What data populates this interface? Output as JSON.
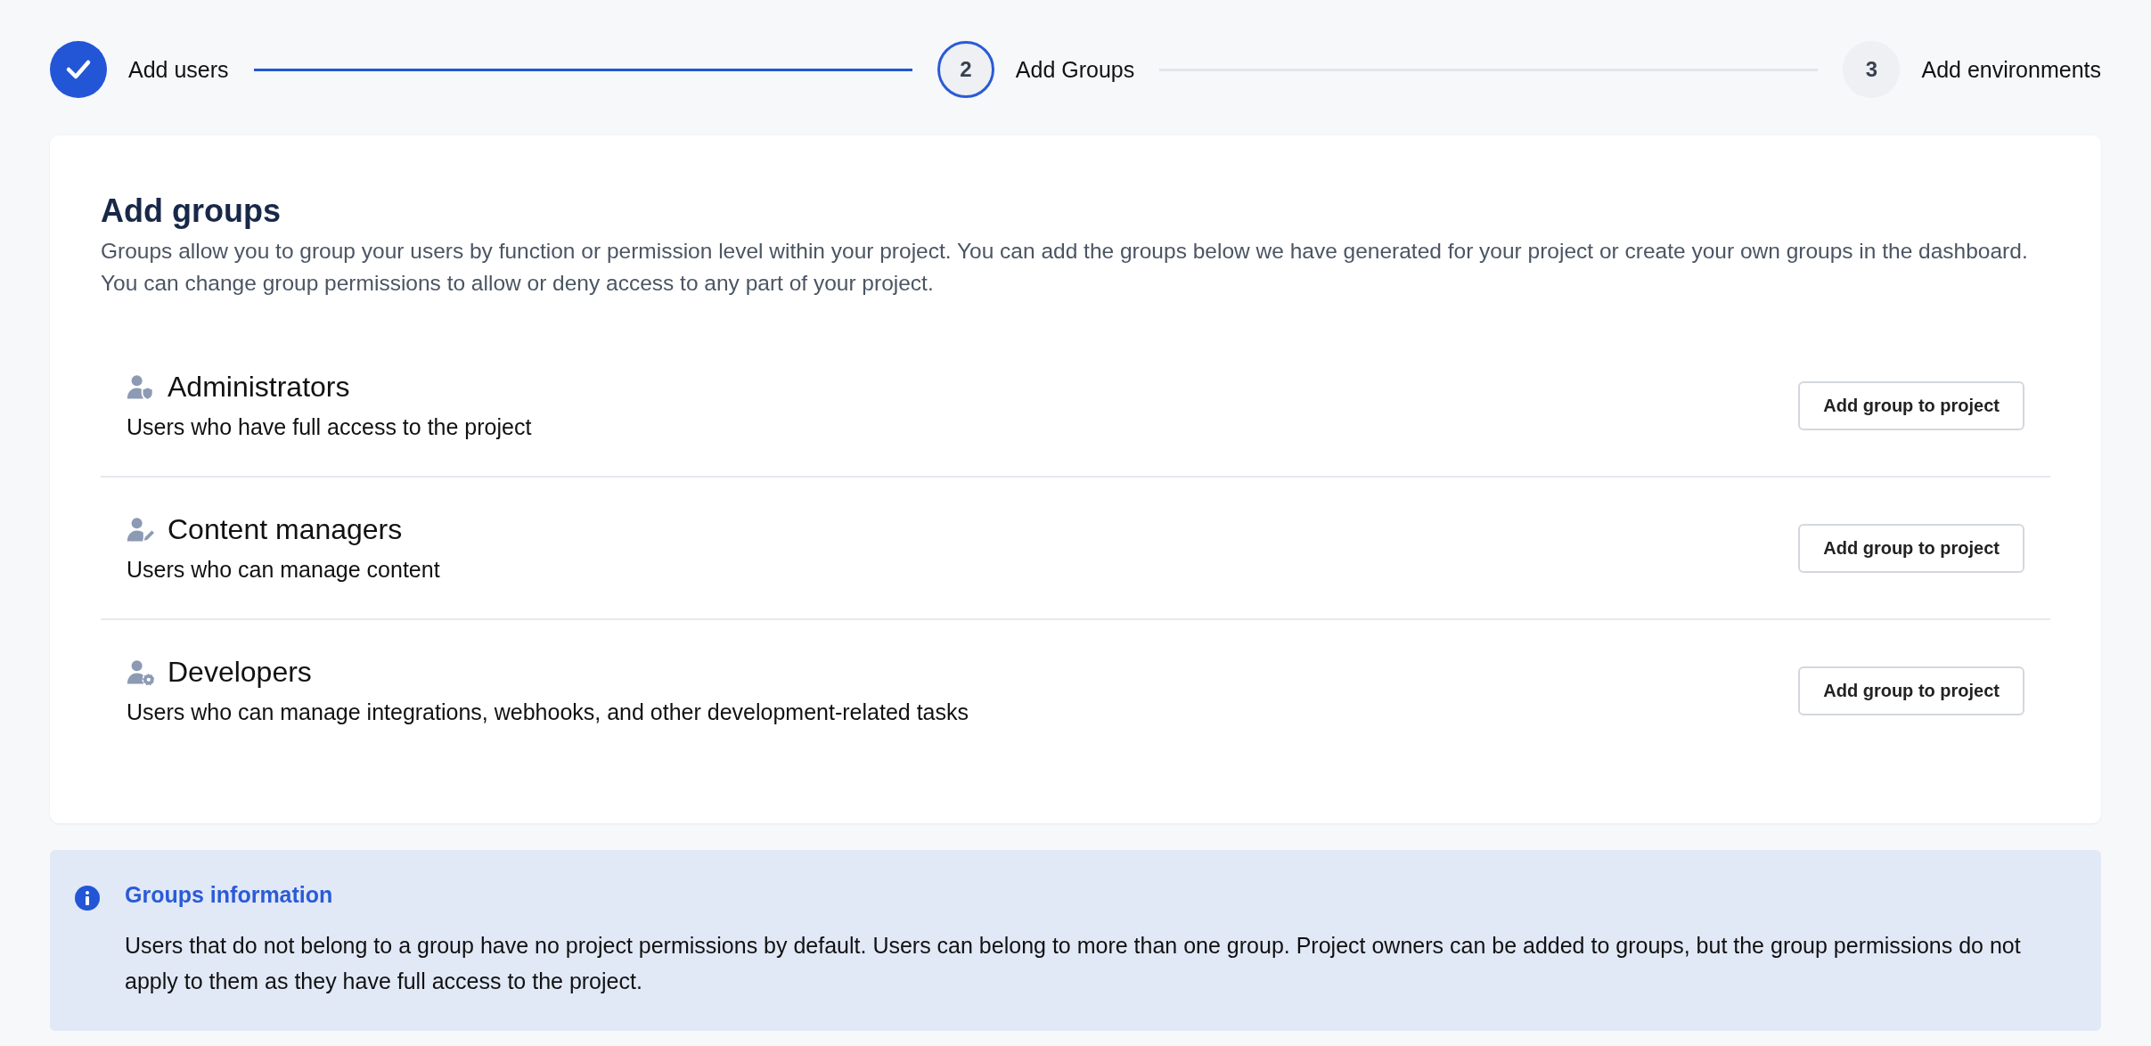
{
  "stepper": [
    {
      "label": "Add users",
      "completed": true,
      "selected": false
    },
    {
      "label": "Add Groups",
      "number": "2",
      "completed": false,
      "selected": true
    },
    {
      "label": "Add environments",
      "number": "3",
      "completed": false,
      "selected": false
    }
  ],
  "panel": {
    "title": "Add groups",
    "description": "Groups allow you to group your users by function or permission level within your project. You can add the groups below we have generated for your project or create your own groups in the dashboard. You can change group permissions to allow or deny access to any part of your project.",
    "groups": [
      {
        "kind": "shield",
        "name": "Administrators",
        "description": "Users who have full access to the project",
        "button": "Add group to project"
      },
      {
        "kind": "pen",
        "name": "Content managers",
        "description": "Users who can manage content",
        "button": "Add group to project"
      },
      {
        "kind": "gear",
        "name": "Developers",
        "description": "Users who can manage integrations, webhooks, and other development-related tasks",
        "button": "Add group to project"
      }
    ]
  },
  "info": {
    "title": "Groups information",
    "text": "Users that do not belong to a group have no project permissions by default. Users can belong to more than one group. Project owners can be added to groups, but the group permissions do not apply to them as they have full access to the project."
  }
}
